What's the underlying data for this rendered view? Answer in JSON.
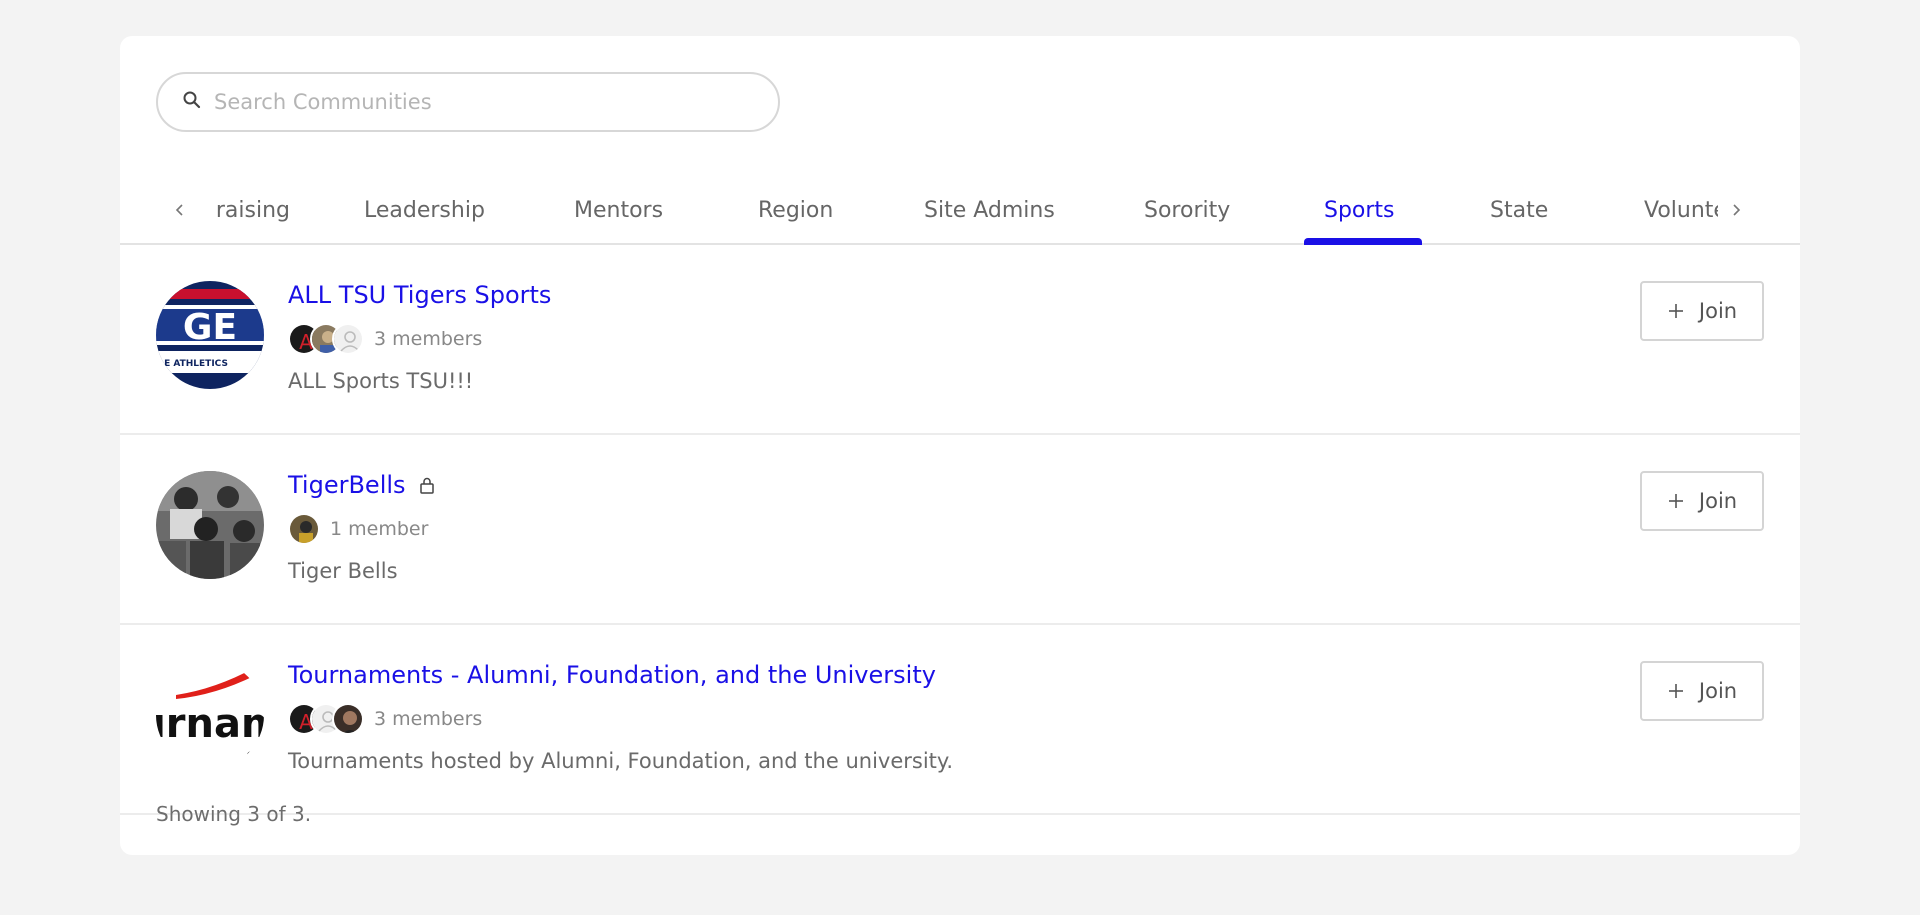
{
  "search": {
    "placeholder": "Search Communities",
    "value": ""
  },
  "tabs": {
    "items": [
      {
        "label": "raising"
      },
      {
        "label": "Leadership"
      },
      {
        "label": "Mentors"
      },
      {
        "label": "Region"
      },
      {
        "label": "Site Admins"
      },
      {
        "label": "Sorority"
      },
      {
        "label": "Sports"
      },
      {
        "label": "State"
      },
      {
        "label": "Volunteers"
      }
    ],
    "active": "Sports"
  },
  "communities": [
    {
      "title": "ALL TSU Tigers Sports",
      "private": false,
      "member_count": "3 members",
      "description": "ALL Sports TSU!!!",
      "join_label": "Join"
    },
    {
      "title": "TigerBells",
      "private": true,
      "member_count": "1 member",
      "description": "Tiger Bells",
      "join_label": "Join"
    },
    {
      "title": "Tournaments - Alumni, Foundation, and the University",
      "private": false,
      "member_count": "3 members",
      "description": "Tournaments hosted by Alumni, Foundation, and the university.",
      "join_label": "Join"
    }
  ],
  "footer": {
    "showing": "Showing 3 of 3."
  },
  "colors": {
    "accent": "#1a10e6",
    "background": "#f3f3f3",
    "card": "#ffffff"
  }
}
